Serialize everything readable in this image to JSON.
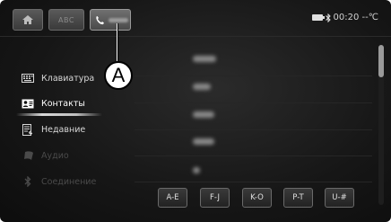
{
  "topbar": {
    "tabs": [
      {
        "name": "home",
        "icon": "home-icon"
      },
      {
        "name": "keypad",
        "icon": "keypad-icon"
      },
      {
        "name": "phone",
        "icon": "phone-icon"
      }
    ],
    "keypad_label": "ABC",
    "time": "00:20 --℃",
    "battery_icon": "battery-icon",
    "bluetooth_icon": "bluetooth-icon"
  },
  "callout": {
    "label": "A"
  },
  "sidebar": {
    "items": [
      {
        "label": "Клавиатура",
        "icon": "keyboard-icon",
        "state": "normal"
      },
      {
        "label": "Контакты",
        "icon": "contacts-icon",
        "state": "active"
      },
      {
        "label": "Недавние",
        "icon": "recent-calls-icon",
        "state": "normal"
      },
      {
        "label": "Аудио",
        "icon": "audio-icon",
        "state": "disabled"
      },
      {
        "label": "Соединение",
        "icon": "bluetooth-icon",
        "state": "disabled"
      }
    ]
  },
  "contacts": {
    "row_count": 5,
    "names_blurred": true
  },
  "alphabet": {
    "buttons": [
      "A-E",
      "F-J",
      "K-O",
      "P-T",
      "U-#"
    ]
  },
  "colors": {
    "background": "#161616",
    "text": "#d8d8d8",
    "disabled": "#4a4a4a"
  }
}
